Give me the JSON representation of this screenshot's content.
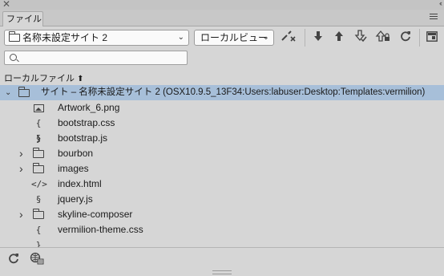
{
  "panel": {
    "tab_label": "ファイル",
    "close": "✕",
    "collapse": "‹‹"
  },
  "toolbar": {
    "site_select": "名称未設定サイト 2",
    "view_select": "ローカルビュー"
  },
  "search": {
    "placeholder": ""
  },
  "column_header": {
    "label": "ローカルファイル",
    "sort_arrow": "🡑"
  },
  "tree": {
    "root": "サイト – 名称未設定サイト 2 (OSX10.9.5_13F34:Users:labuser:Desktop:Templates:vermilion)",
    "items": [
      {
        "label": "Artwork_6.png",
        "icon": "image-icon"
      },
      {
        "label": "bootstrap.css",
        "icon": "css-icon"
      },
      {
        "label": "bootstrap.js",
        "icon": "js-icon"
      },
      {
        "label": "bourbon",
        "icon": "folder-icon",
        "expandable": true
      },
      {
        "label": "images",
        "icon": "folder-icon",
        "expandable": true
      },
      {
        "label": "index.html",
        "icon": "html-icon"
      },
      {
        "label": "jquery.js",
        "icon": "js-icon"
      },
      {
        "label": "skyline-composer",
        "icon": "folder-icon",
        "expandable": true
      },
      {
        "label": "vermilion-theme.css",
        "icon": "css-icon"
      }
    ]
  },
  "colors": {
    "selection": "#a7bfd9",
    "background": "#d6d6d6"
  }
}
